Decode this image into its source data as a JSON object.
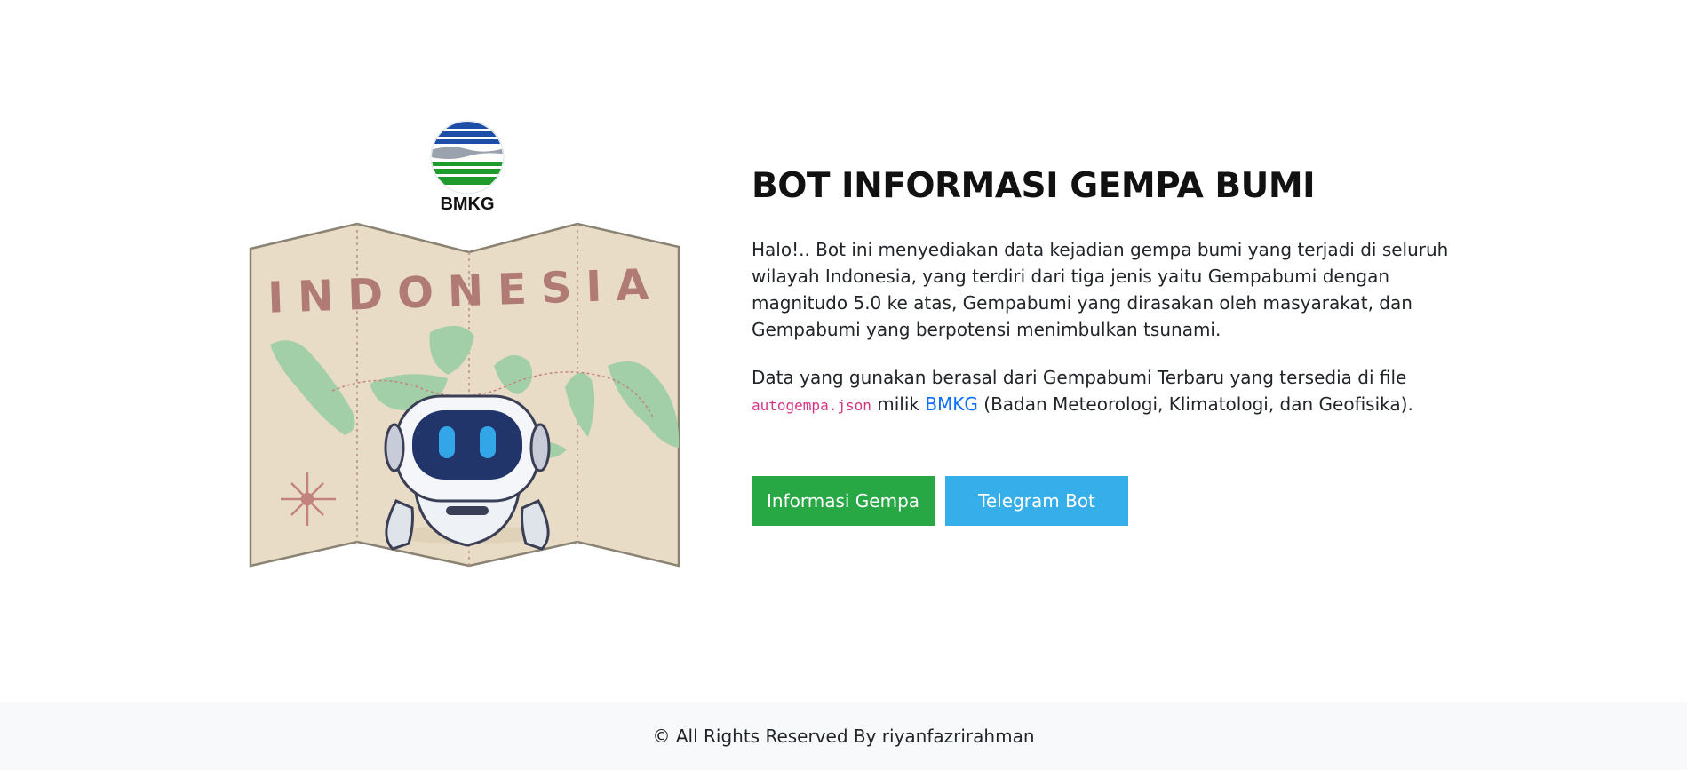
{
  "hero": {
    "title": "BOT INFORMASI GEMPA BUMI",
    "paragraph1": "Halo!.. Bot ini menyediakan data kejadian gempa bumi yang terjadi di seluruh wilayah Indonesia, yang terdiri dari tiga jenis yaitu Gempabumi dengan magnitudo 5.0 ke atas, Gempabumi yang dirasakan oleh masyarakat, dan Gempabumi yang berpotensi menimbulkan tsunami.",
    "paragraph2_prefix": "Data yang gunakan berasal dari Gempabumi Terbaru yang tersedia di file",
    "paragraph2_code": "autogempa.json",
    "paragraph2_middle": "milik",
    "paragraph2_link": "BMKG",
    "paragraph2_suffix": "(Badan Meteorologi, Klimatologi, dan Geofisika).",
    "buttons": {
      "info": "Informasi Gempa",
      "telegram": "Telegram Bot"
    }
  },
  "illustration": {
    "logo_text": "BMKG",
    "map_text": "INDONESIA",
    "icons": [
      "bmkg-logo",
      "map",
      "robot",
      "compass-star"
    ]
  },
  "colors": {
    "green": "#28a745",
    "blue": "#35aeea",
    "link": "#0d6efd",
    "code": "#d63384"
  },
  "footer": {
    "text": "© All Rights Reserved By riyanfazrirahman"
  }
}
